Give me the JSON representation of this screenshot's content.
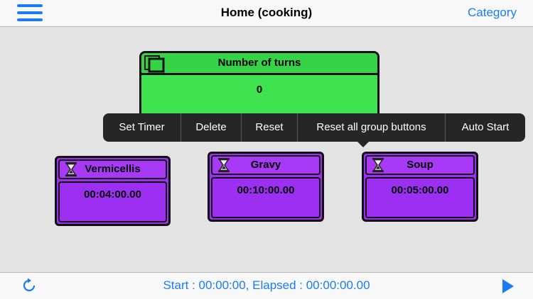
{
  "nav": {
    "title": "Home (cooking)",
    "right_label": "Category",
    "menu_icon": "hamburger-menu-icon"
  },
  "counter": {
    "title": "Number of turns",
    "value": "0",
    "icon": "copy-icon"
  },
  "context_menu": {
    "items": [
      "Set Timer",
      "Delete",
      "Reset",
      "Reset all group buttons",
      "Auto Start"
    ]
  },
  "timers": [
    {
      "name": "Vermicellis",
      "time": "00:04:00.00",
      "icon": "hourglass-icon"
    },
    {
      "name": "Gravy",
      "time": "00:10:00.00",
      "icon": "hourglass-icon"
    },
    {
      "name": "Soup",
      "time": "00:05:00.00",
      "icon": "hourglass-icon"
    }
  ],
  "toolbar": {
    "status": "Start : 00:00:00, Elapsed : 00:00:00.00",
    "left_icon": "refresh-icon",
    "right_icon": "play-icon"
  },
  "colors": {
    "accent": "#1a7cf5",
    "counter_green": "#3fe24f",
    "timer_purple": "#9d2ff2",
    "menu_bg": "#262626"
  }
}
